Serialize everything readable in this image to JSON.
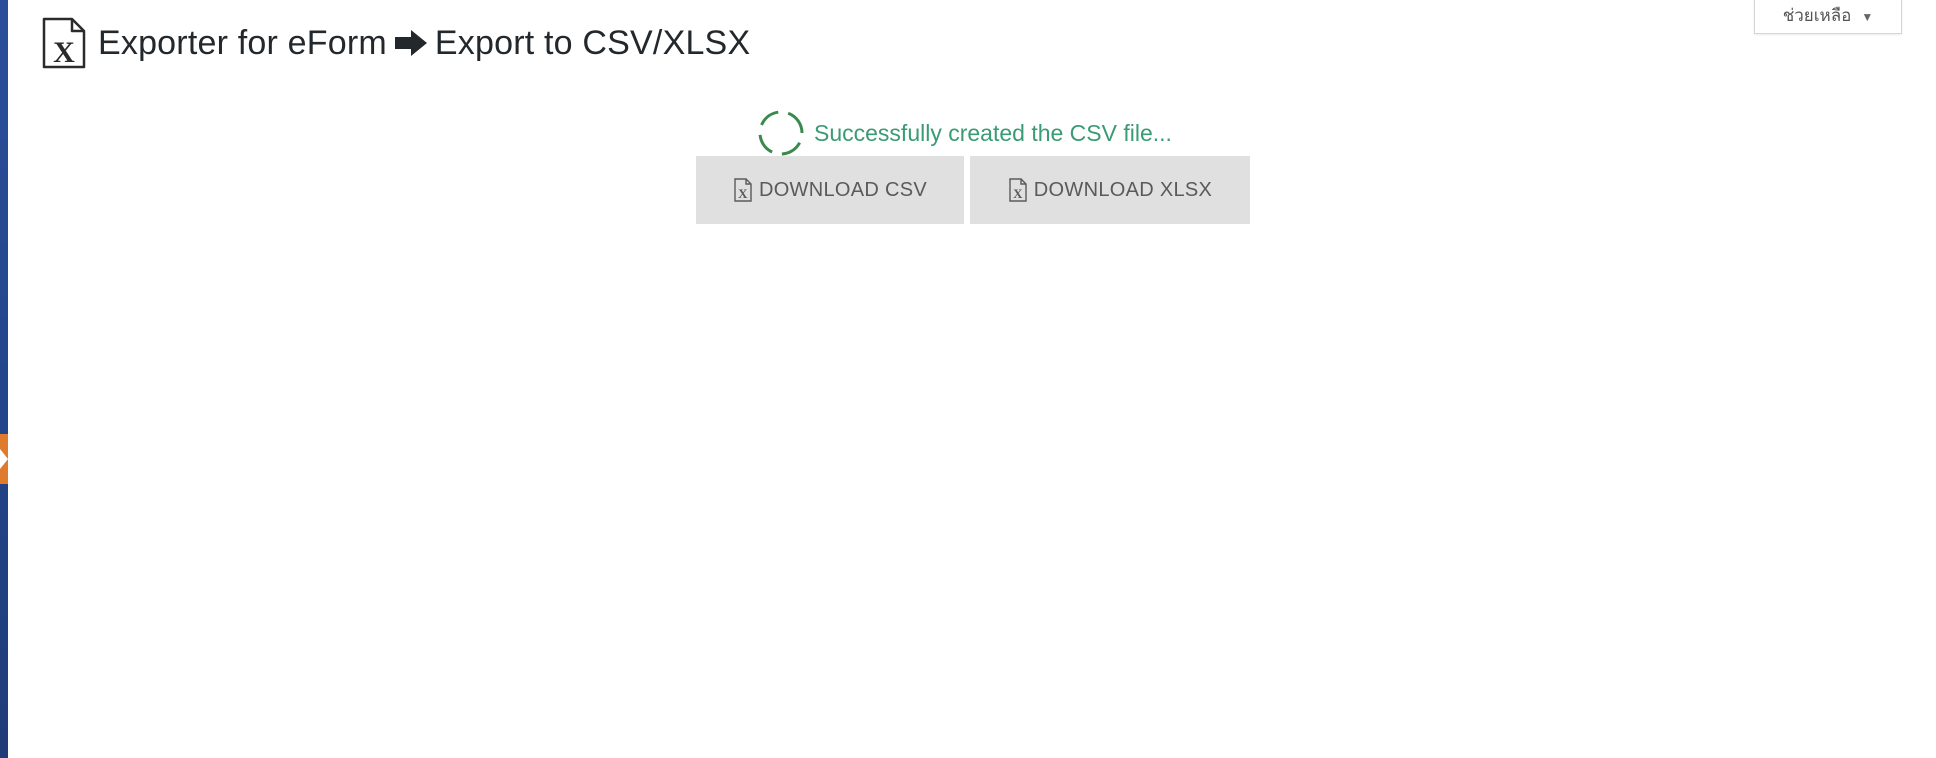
{
  "help_menu": {
    "label": "ช่วยเหลือ",
    "caret": "▼"
  },
  "header": {
    "title_part1": "Exporter for eForm",
    "title_part2": "Export to CSV/XLSX",
    "icon": "excel-file-icon",
    "separator_icon": "arrow-right-icon"
  },
  "status": {
    "message": "Successfully created the CSV file...",
    "color": "#3a9b74",
    "icon": "spinner-icon"
  },
  "downloads": {
    "csv_label": "DOWNLOAD CSV",
    "xlsx_label": "DOWNLOAD XLSX",
    "icon": "excel-file-icon"
  },
  "colors": {
    "sidebar": "#23448a",
    "sidebar_toggle": "#e07a2c",
    "button_bg": "#e0e0e0"
  }
}
